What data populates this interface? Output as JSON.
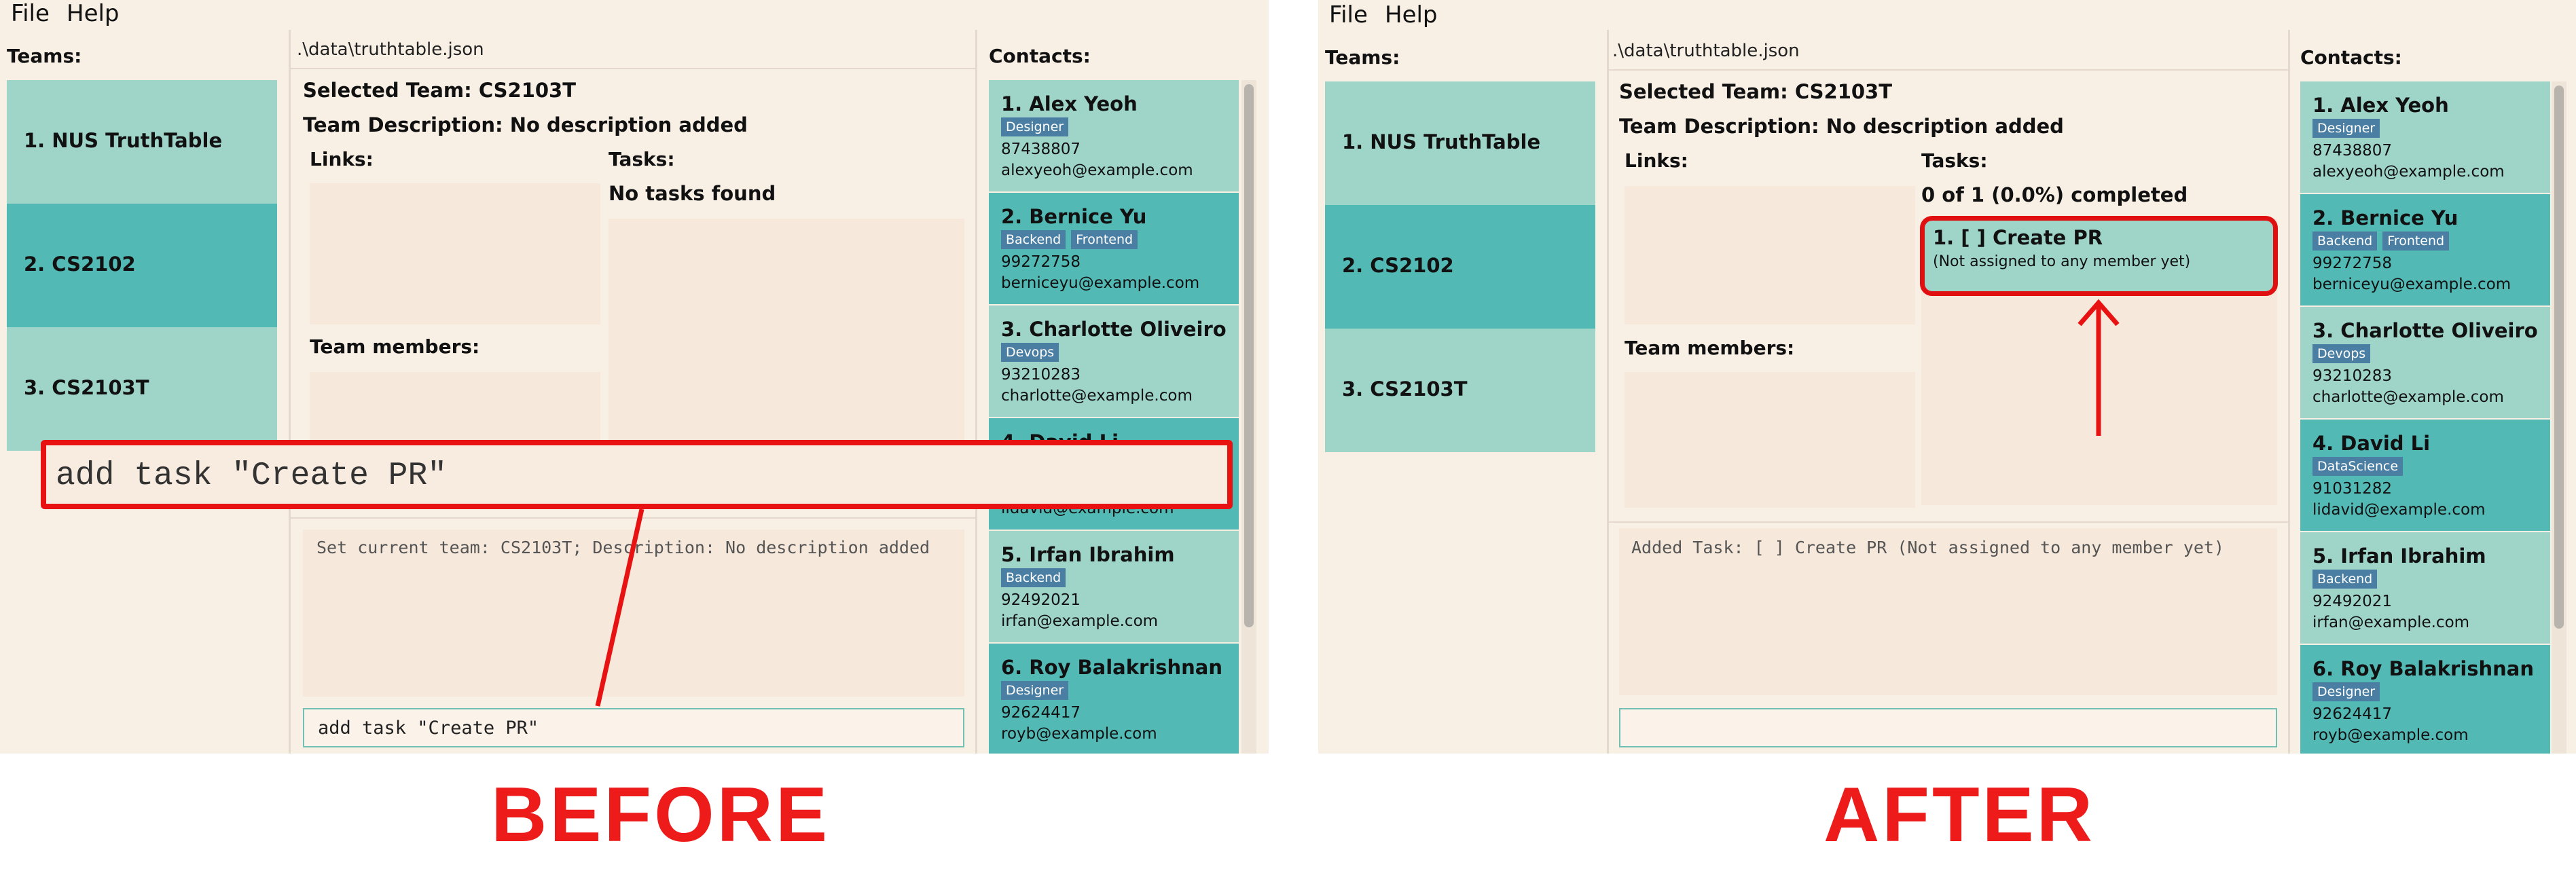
{
  "menu": {
    "file": "File",
    "help": "Help"
  },
  "titles": {
    "teams": "Teams:",
    "contacts": "Contacts:",
    "links": "Links:",
    "tasks": "Tasks:",
    "team_members": "Team members:"
  },
  "file_path": ".\\data\\truthtable.json",
  "teams": [
    {
      "label": "1. NUS TruthTable"
    },
    {
      "label": "2. CS2102"
    },
    {
      "label": "3. CS2103T"
    }
  ],
  "selected_team": "Selected Team: CS2103T",
  "team_description": "Team Description: No description added",
  "contacts": [
    {
      "name": "1. Alex Yeoh",
      "tags": [
        "Designer"
      ],
      "phone": "87438807",
      "email": "alexyeoh@example.com"
    },
    {
      "name": "2. Bernice Yu",
      "tags": [
        "Backend",
        "Frontend"
      ],
      "phone": "99272758",
      "email": "berniceyu@example.com"
    },
    {
      "name": "3. Charlotte Oliveiro",
      "tags": [
        "Devops"
      ],
      "phone": "93210283",
      "email": "charlotte@example.com"
    },
    {
      "name": "4. David Li",
      "tags": [
        "DataScience"
      ],
      "phone": "91031282",
      "email": "lidavid@example.com"
    },
    {
      "name": "5. Irfan Ibrahim",
      "tags": [
        "Backend"
      ],
      "phone": "92492021",
      "email": "irfan@example.com"
    },
    {
      "name": "6. Roy Balakrishnan",
      "tags": [
        "Designer"
      ],
      "phone": "92624417",
      "email": "royb@example.com"
    }
  ],
  "before": {
    "tasks_status": "No tasks found",
    "result": "Set current team: CS2103T; Description: No description added",
    "command": "add task \"Create PR\"",
    "callout": "add task \"Create PR\"",
    "label": "BEFORE"
  },
  "after": {
    "tasks_status": "0 of 1 (0.0%) completed",
    "task": {
      "title": "1. [ ] Create PR",
      "assignee": "(Not assigned to any member yet)"
    },
    "result": "Added Task: [ ] Create PR (Not assigned to any member yet)",
    "command": "",
    "label": "AFTER"
  },
  "colors": {
    "window_bg": "#f8efe5",
    "team_item": "#9fd5c9",
    "team_selected": "#52b9b5",
    "tag": "#4a7fa3",
    "annotation": "#e81212"
  }
}
